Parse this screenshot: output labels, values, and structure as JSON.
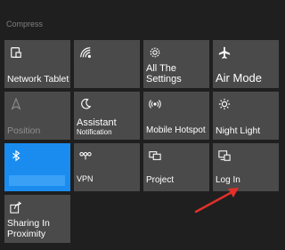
{
  "header": {
    "collapse_label": "Compress"
  },
  "tiles": [
    {
      "icon": "tablet-mode-icon",
      "label": "Network Tablet Mode"
    },
    {
      "icon": "network-icon",
      "label": ""
    },
    {
      "icon": "settings-gear-icon",
      "label": "All The Settings"
    },
    {
      "icon": "airplane-icon",
      "label": "Air Mode"
    },
    {
      "icon": "location-icon",
      "label": "Position"
    },
    {
      "icon": "moon-icon",
      "label": "Assistant",
      "sublabel": "Notification"
    },
    {
      "icon": "hotspot-icon",
      "label": "Mobile Hotspot"
    },
    {
      "icon": "brightness-icon",
      "label": "Night Light"
    },
    {
      "icon": "bluetooth-icon",
      "label": ""
    },
    {
      "icon": "vpn-icon",
      "label": "VPN"
    },
    {
      "icon": "project-icon",
      "label": "Project"
    },
    {
      "icon": "connect-icon",
      "label": "Log In"
    },
    {
      "icon": "share-icon",
      "label": "Sharing In Proximity"
    }
  ],
  "annotation": {
    "color": "#e0302a"
  }
}
